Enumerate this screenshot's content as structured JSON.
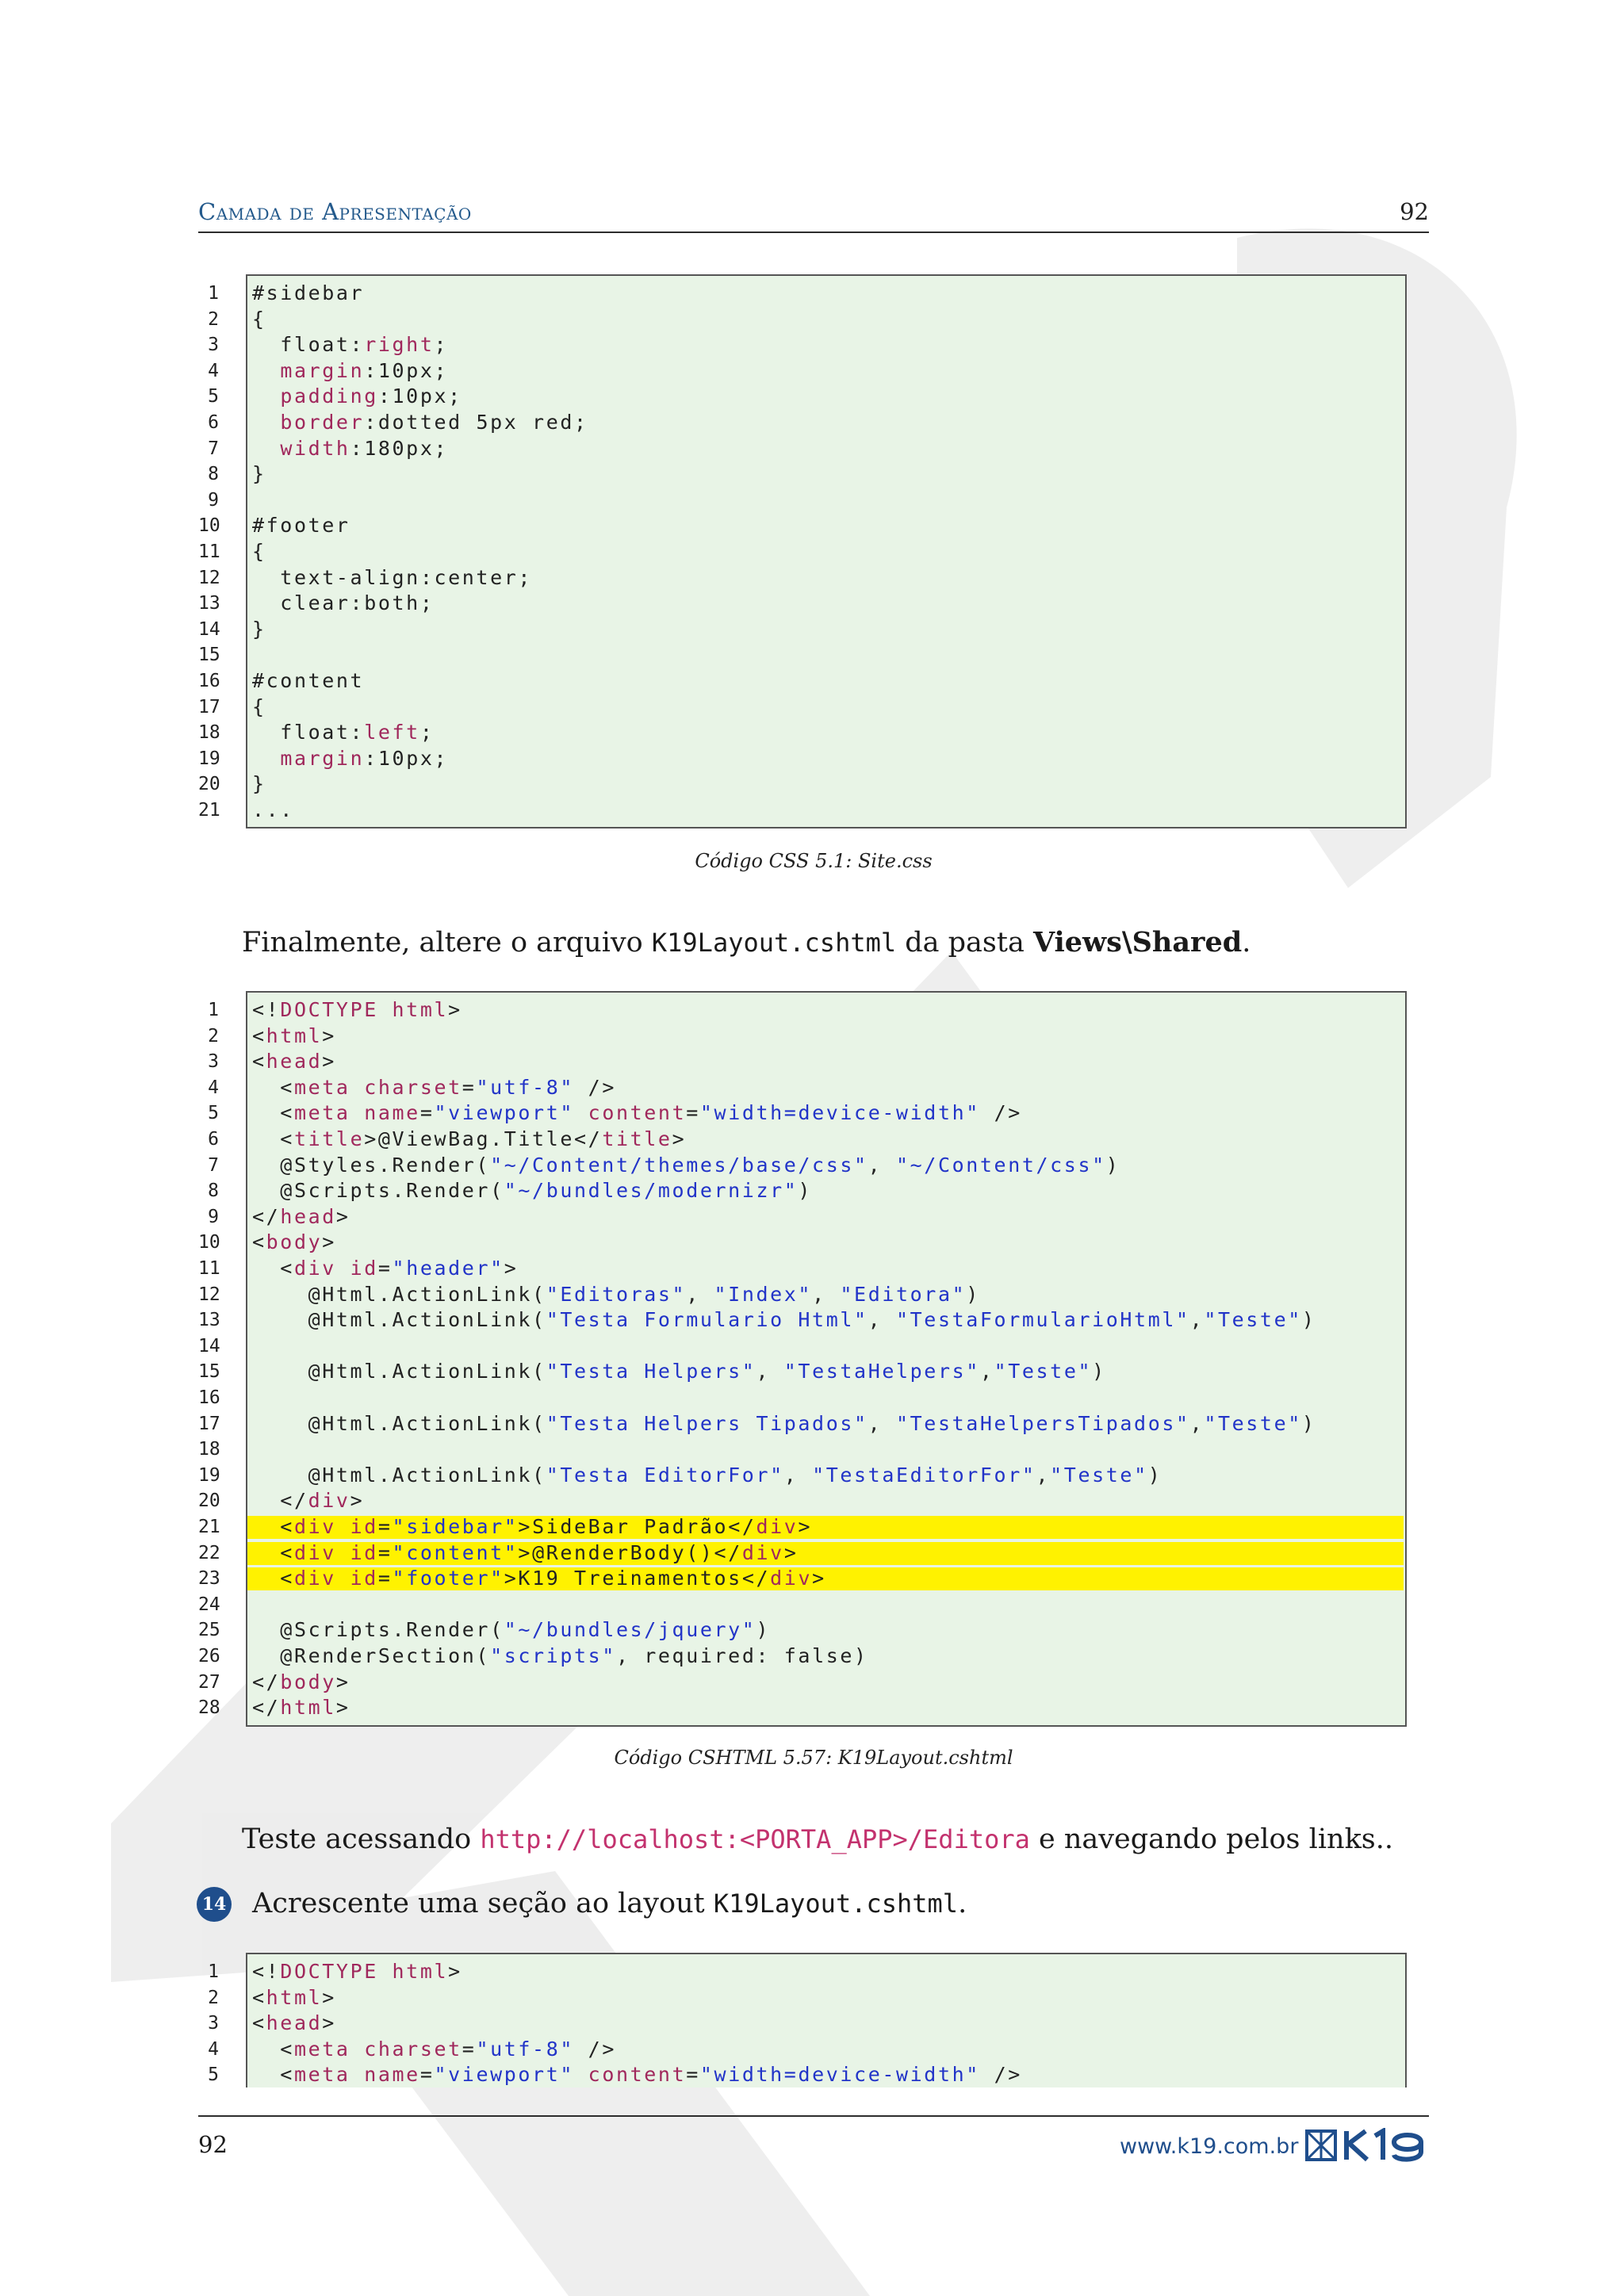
{
  "header": {
    "section_title": "Camada de Apresentação",
    "page_number": "92"
  },
  "listing1": {
    "lines": [
      [
        [
          "pl",
          "#sidebar"
        ]
      ],
      [
        [
          "pl",
          "{"
        ]
      ],
      [
        [
          "pl",
          "  float:"
        ],
        [
          "prop",
          "right"
        ],
        [
          "pl",
          ";"
        ]
      ],
      [
        [
          "pl",
          "  "
        ],
        [
          "prop",
          "margin"
        ],
        [
          "pl",
          ":10px;"
        ]
      ],
      [
        [
          "pl",
          "  "
        ],
        [
          "prop",
          "padding"
        ],
        [
          "pl",
          ":10px;"
        ]
      ],
      [
        [
          "pl",
          "  "
        ],
        [
          "prop",
          "border"
        ],
        [
          "pl",
          ":dotted 5px red;"
        ]
      ],
      [
        [
          "pl",
          "  "
        ],
        [
          "prop",
          "width"
        ],
        [
          "pl",
          ":180px;"
        ]
      ],
      [
        [
          "pl",
          "}"
        ]
      ],
      [],
      [
        [
          "pl",
          "#footer"
        ]
      ],
      [
        [
          "pl",
          "{"
        ]
      ],
      [
        [
          "pl",
          "  text-align:center;"
        ]
      ],
      [
        [
          "pl",
          "  clear:both;"
        ]
      ],
      [
        [
          "pl",
          "}"
        ]
      ],
      [],
      [
        [
          "pl",
          "#content"
        ]
      ],
      [
        [
          "pl",
          "{"
        ]
      ],
      [
        [
          "pl",
          "  float:"
        ],
        [
          "prop",
          "left"
        ],
        [
          "pl",
          ";"
        ]
      ],
      [
        [
          "pl",
          "  "
        ],
        [
          "prop",
          "margin"
        ],
        [
          "pl",
          ":10px;"
        ]
      ],
      [
        [
          "pl",
          "}"
        ]
      ],
      [
        [
          "pl",
          "..."
        ]
      ]
    ],
    "caption": "Código CSS 5.1: Site.css"
  },
  "para1": {
    "before": "Finalmente, altere o arquivo ",
    "code": "K19Layout.cshtml",
    "middle": " da pasta ",
    "bold": "Views\\Shared",
    "after": "."
  },
  "listing2": {
    "highlight": [
      21,
      22,
      23
    ],
    "lines": [
      [
        [
          "pl",
          "<!"
        ],
        [
          "tag",
          "DOCTYPE html"
        ],
        [
          "pl",
          ">"
        ]
      ],
      [
        [
          "pl",
          "<"
        ],
        [
          "tag",
          "html"
        ],
        [
          "pl",
          ">"
        ]
      ],
      [
        [
          "pl",
          "<"
        ],
        [
          "tag",
          "head"
        ],
        [
          "pl",
          ">"
        ]
      ],
      [
        [
          "pl",
          "  <"
        ],
        [
          "tag",
          "meta charset"
        ],
        [
          "pl",
          "="
        ],
        [
          "str",
          "\"utf-8\""
        ],
        [
          "pl",
          " />"
        ]
      ],
      [
        [
          "pl",
          "  <"
        ],
        [
          "tag",
          "meta name"
        ],
        [
          "pl",
          "="
        ],
        [
          "str",
          "\"viewport\""
        ],
        [
          "pl",
          " "
        ],
        [
          "tag",
          "content"
        ],
        [
          "pl",
          "="
        ],
        [
          "str",
          "\"width=device-width\""
        ],
        [
          "pl",
          " />"
        ]
      ],
      [
        [
          "pl",
          "  <"
        ],
        [
          "tag",
          "title"
        ],
        [
          "pl",
          ">@ViewBag.Title</"
        ],
        [
          "tag",
          "title"
        ],
        [
          "pl",
          ">"
        ]
      ],
      [
        [
          "pl",
          "  @Styles.Render("
        ],
        [
          "str",
          "\"~/Content/themes/base/css\""
        ],
        [
          "pl",
          ", "
        ],
        [
          "str",
          "\"~/Content/css\""
        ],
        [
          "pl",
          ")"
        ]
      ],
      [
        [
          "pl",
          "  @Scripts.Render("
        ],
        [
          "str",
          "\"~/bundles/modernizr\""
        ],
        [
          "pl",
          ")"
        ]
      ],
      [
        [
          "pl",
          "</"
        ],
        [
          "tag",
          "head"
        ],
        [
          "pl",
          ">"
        ]
      ],
      [
        [
          "pl",
          "<"
        ],
        [
          "tag",
          "body"
        ],
        [
          "pl",
          ">"
        ]
      ],
      [
        [
          "pl",
          "  <"
        ],
        [
          "tag",
          "div id"
        ],
        [
          "pl",
          "="
        ],
        [
          "str",
          "\"header\""
        ],
        [
          "pl",
          ">"
        ]
      ],
      [
        [
          "pl",
          "    @Html.ActionLink("
        ],
        [
          "str",
          "\"Editoras\""
        ],
        [
          "pl",
          ", "
        ],
        [
          "str",
          "\"Index\""
        ],
        [
          "pl",
          ", "
        ],
        [
          "str",
          "\"Editora\""
        ],
        [
          "pl",
          ")"
        ]
      ],
      [
        [
          "pl",
          "    @Html.ActionLink("
        ],
        [
          "str",
          "\"Testa Formulario Html\""
        ],
        [
          "pl",
          ", "
        ],
        [
          "str",
          "\"TestaFormularioHtml\""
        ],
        [
          "pl",
          ","
        ],
        [
          "str",
          "\"Teste\""
        ],
        [
          "pl",
          ")"
        ]
      ],
      [],
      [
        [
          "pl",
          "    @Html.ActionLink("
        ],
        [
          "str",
          "\"Testa Helpers\""
        ],
        [
          "pl",
          ", "
        ],
        [
          "str",
          "\"TestaHelpers\""
        ],
        [
          "pl",
          ","
        ],
        [
          "str",
          "\"Teste\""
        ],
        [
          "pl",
          ")"
        ]
      ],
      [],
      [
        [
          "pl",
          "    @Html.ActionLink("
        ],
        [
          "str",
          "\"Testa Helpers Tipados\""
        ],
        [
          "pl",
          ", "
        ],
        [
          "str",
          "\"TestaHelpersTipados\""
        ],
        [
          "pl",
          ","
        ],
        [
          "str",
          "\"Teste\""
        ],
        [
          "pl",
          ")"
        ]
      ],
      [],
      [
        [
          "pl",
          "    @Html.ActionLink("
        ],
        [
          "str",
          "\"Testa EditorFor\""
        ],
        [
          "pl",
          ", "
        ],
        [
          "str",
          "\"TestaEditorFor\""
        ],
        [
          "pl",
          ","
        ],
        [
          "str",
          "\"Teste\""
        ],
        [
          "pl",
          ")"
        ]
      ],
      [
        [
          "pl",
          "  </"
        ],
        [
          "tag",
          "div"
        ],
        [
          "pl",
          ">"
        ]
      ],
      [
        [
          "pl",
          "  <"
        ],
        [
          "tag",
          "div id"
        ],
        [
          "pl",
          "="
        ],
        [
          "str",
          "\"sidebar\""
        ],
        [
          "pl",
          ">SideBar Padrão</"
        ],
        [
          "tag",
          "div"
        ],
        [
          "pl",
          ">"
        ]
      ],
      [
        [
          "pl",
          "  <"
        ],
        [
          "tag",
          "div id"
        ],
        [
          "pl",
          "="
        ],
        [
          "str",
          "\"content\""
        ],
        [
          "pl",
          ">@RenderBody()</"
        ],
        [
          "tag",
          "div"
        ],
        [
          "pl",
          ">"
        ]
      ],
      [
        [
          "pl",
          "  <"
        ],
        [
          "tag",
          "div id"
        ],
        [
          "pl",
          "="
        ],
        [
          "str",
          "\"footer\""
        ],
        [
          "pl",
          ">K19 Treinamentos</"
        ],
        [
          "tag",
          "div"
        ],
        [
          "pl",
          ">"
        ]
      ],
      [],
      [
        [
          "pl",
          "  @Scripts.Render("
        ],
        [
          "str",
          "\"~/bundles/jquery\""
        ],
        [
          "pl",
          ")"
        ]
      ],
      [
        [
          "pl",
          "  @RenderSection("
        ],
        [
          "str",
          "\"scripts\""
        ],
        [
          "pl",
          ", required: false)"
        ]
      ],
      [
        [
          "pl",
          "</"
        ],
        [
          "tag",
          "body"
        ],
        [
          "pl",
          ">"
        ]
      ],
      [
        [
          "pl",
          "</"
        ],
        [
          "tag",
          "html"
        ],
        [
          "pl",
          ">"
        ]
      ]
    ],
    "caption": "Código CSHTML 5.57: K19Layout.cshtml"
  },
  "para2": {
    "before": "Teste acessando ",
    "url": "http://localhost:<PORTA_APP>/Editora",
    "after": " e navegando pelos links.."
  },
  "step": {
    "number": "14",
    "before": "Acrescente uma seção ao layout ",
    "code": "K19Layout.cshtml",
    "after": "."
  },
  "listing3": {
    "lines": [
      [
        [
          "pl",
          "<!"
        ],
        [
          "tag",
          "DOCTYPE html"
        ],
        [
          "pl",
          ">"
        ]
      ],
      [
        [
          "pl",
          "<"
        ],
        [
          "tag",
          "html"
        ],
        [
          "pl",
          ">"
        ]
      ],
      [
        [
          "pl",
          "<"
        ],
        [
          "tag",
          "head"
        ],
        [
          "pl",
          ">"
        ]
      ],
      [
        [
          "pl",
          "  <"
        ],
        [
          "tag",
          "meta charset"
        ],
        [
          "pl",
          "="
        ],
        [
          "str",
          "\"utf-8\""
        ],
        [
          "pl",
          " />"
        ]
      ],
      [
        [
          "pl",
          "  <"
        ],
        [
          "tag",
          "meta name"
        ],
        [
          "pl",
          "="
        ],
        [
          "str",
          "\"viewport\""
        ],
        [
          "pl",
          " "
        ],
        [
          "tag",
          "content"
        ],
        [
          "pl",
          "="
        ],
        [
          "str",
          "\"width=device-width\""
        ],
        [
          "pl",
          " />"
        ]
      ]
    ]
  },
  "footer": {
    "page_number": "92",
    "url": "www.k19.com.br",
    "logo_text": "K19"
  },
  "colors": {
    "code_bg": "#e8f4e6",
    "highlight": "#fff200",
    "keyword": "#a0285c",
    "string": "#2234c8",
    "accent": "#1f4e8c"
  }
}
